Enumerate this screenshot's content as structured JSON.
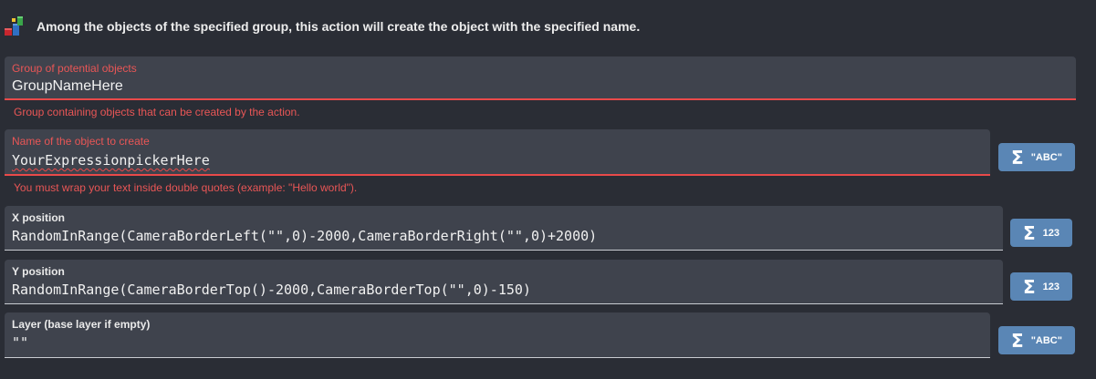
{
  "header": {
    "icon": "create-object-icon",
    "text": "Among the objects of the specified group, this action will create the object with the specified name."
  },
  "fields": {
    "group": {
      "label": "Group of potential objects",
      "value": "GroupNameHere",
      "helper": "Group containing objects that can be created by the action."
    },
    "object_name": {
      "label": "Name of the object to create",
      "value": "YourExpressionpickerHere",
      "helper": "You must wrap your text inside double quotes (example: \"Hello world\").",
      "picker_label": "\"ABC\""
    },
    "x_position": {
      "label": "X position",
      "value": "RandomInRange(CameraBorderLeft(\"\",0)-2000,CameraBorderRight(\"\",0)+2000)",
      "picker_label": "123"
    },
    "y_position": {
      "label": "Y position",
      "value": "RandomInRange(CameraBorderTop()-2000,CameraBorderTop(\"\",0)-150)",
      "picker_label": "123"
    },
    "layer": {
      "label": "Layer (base layer if empty)",
      "value": "\"\"",
      "picker_label": "\"ABC\""
    }
  },
  "colors": {
    "background": "#2a2d35",
    "field_background": "#3f434d",
    "error": "#e94a4a",
    "picker_button": "#5a86b5"
  },
  "icons": {
    "picker": "sigma-icon"
  }
}
